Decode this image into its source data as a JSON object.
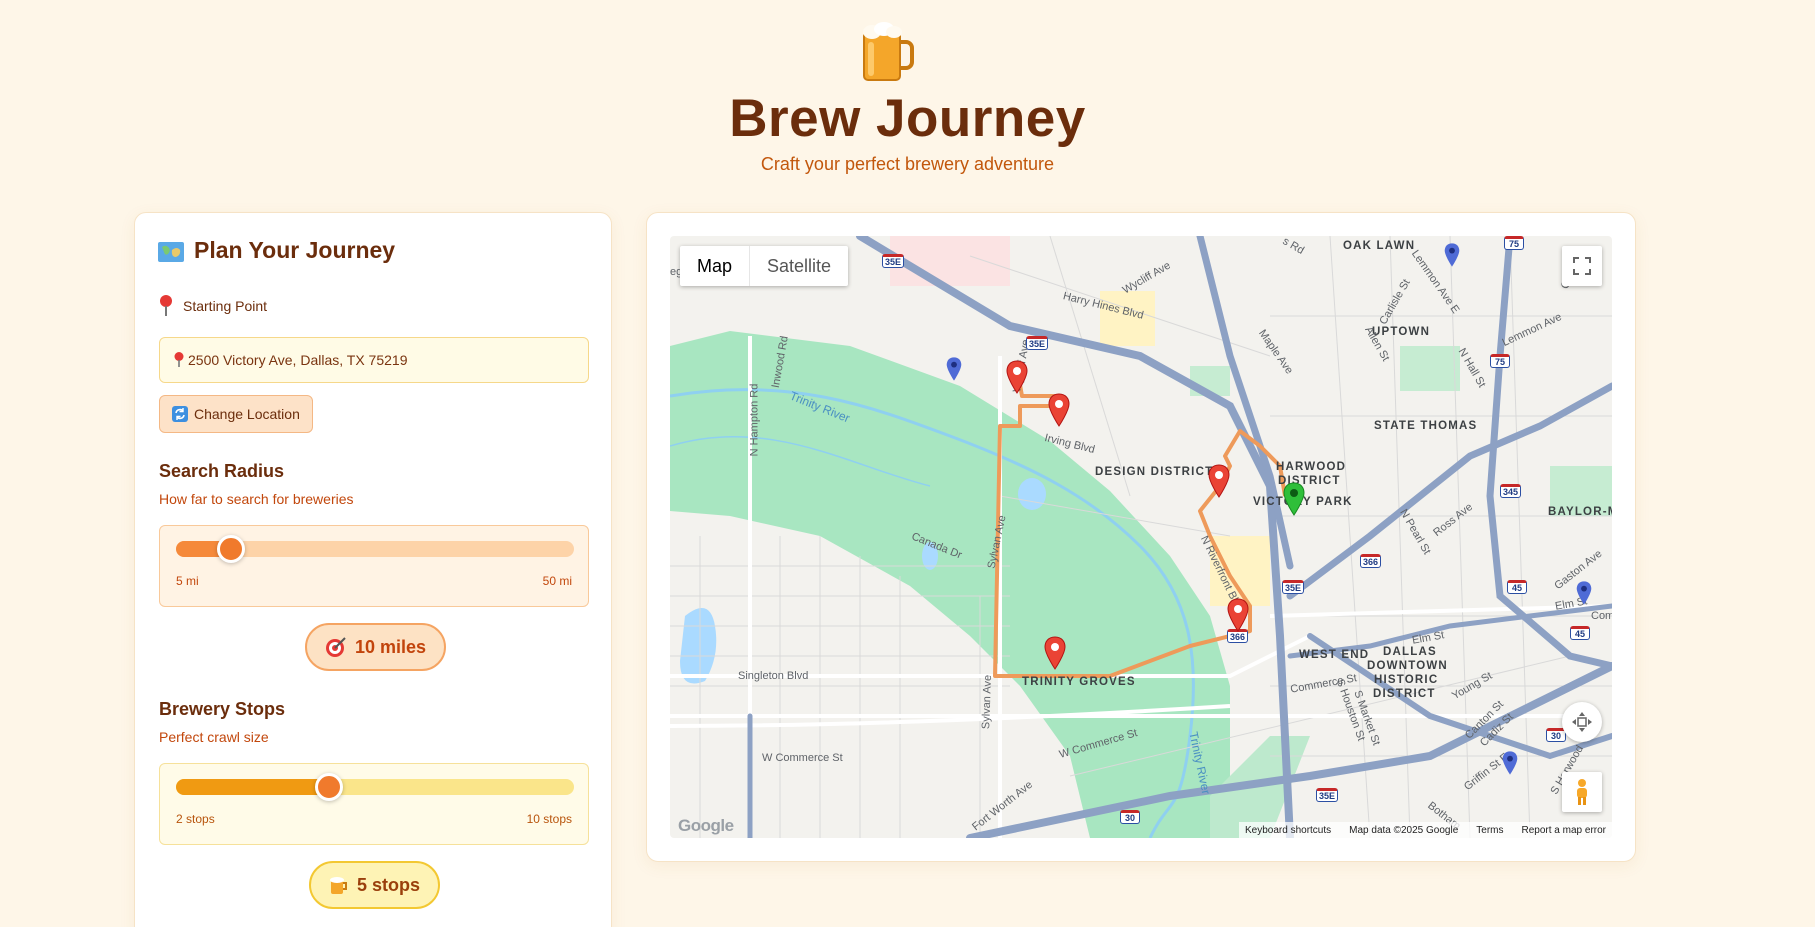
{
  "header": {
    "title": "Brew Journey",
    "tagline": "Craft your perfect brewery adventure"
  },
  "planner": {
    "title": "Plan Your Journey",
    "starting_point_label": "Starting Point",
    "address": "2500 Victory Ave, Dallas, TX 75219",
    "change_location_label": "Change Location",
    "radius": {
      "title": "Search Radius",
      "subtitle": "How far to search for breweries",
      "min_label": "5 mi",
      "max_label": "50 mi",
      "min": 5,
      "max": 50,
      "value": 10,
      "display": "10 miles"
    },
    "stops": {
      "title": "Brewery Stops",
      "subtitle": "Perfect crawl size",
      "min_label": "2 stops",
      "max_label": "10 stops",
      "min": 2,
      "max": 10,
      "value": 5,
      "display": "5 stops"
    }
  },
  "map": {
    "type_options": [
      "Map",
      "Satellite"
    ],
    "selected_type": "Map",
    "neighborhoods": {
      "oak_lawn": "OAK LAWN",
      "uptown": "UPTOWN",
      "state_thomas": "STATE THOMAS",
      "harwood": "HARWOOD",
      "district": "DISTRICT",
      "victory_park": "VICTORY PARK",
      "design_district": "DESIGN DISTRICT",
      "baylor": "BAYLOR-M",
      "west_end": "WEST END",
      "dallas": "DALLAS",
      "downtown": "DOWNTOWN",
      "historic": "HISTORIC",
      "district2": "DISTRICT",
      "trinity_groves": "TRINITY GROVES"
    },
    "streets": {
      "harry_hines": "Harry Hines Blvd",
      "wycliff": "Wycliff Ave",
      "wycliff2": "Wycliff Ave",
      "maple": "Maple Ave",
      "lemmon_e": "Lemmon Ave E",
      "lemmon": "Lemmon Ave",
      "carlisle": "Carlisle St",
      "allen": "Allen St",
      "n_hall": "N Hall St",
      "irving": "Irving Blvd",
      "n_hampton": "N Hampton Rd",
      "inwood": "Inwood Rd",
      "canada": "Canada Dr",
      "sylvan": "Sylvan Ave",
      "sylvan2": "Sylvan Ave",
      "riverfront": "N Riverfront Blvd",
      "n_pearl": "N Pearl St",
      "ross": "Ross Ave",
      "gaston": "Gaston Ave",
      "elm": "Elm St",
      "elm2": "Elm St",
      "commerce": "Commerce St",
      "s_houston": "S Houston St",
      "s_market": "S Market St",
      "young": "Young St",
      "canton": "Canton St",
      "cadiz": "Cadiz St",
      "singleton": "Singleton Blvd",
      "w_commerce": "W Commerce St",
      "w_commerce2": "W Commerce St",
      "fort_worth": "Fort Worth Ave",
      "griffin": "Griffin St E",
      "harwood": "S Harwood",
      "botham": "Botham",
      "trinity_river": "Trinity River",
      "trinity_river2": "Trinity River",
      "cl": "Co",
      "comm_r": "Comr",
      "ol_rd": "s Rd",
      "eg": "eg"
    },
    "highways": {
      "h35e_a": "35E",
      "h35e_b": "35E",
      "h35e_c": "35E",
      "h35e_d": "35E",
      "h75a": "75",
      "h75b": "75",
      "h345": "345",
      "h45a": "45",
      "h45b": "45",
      "h366a": "366",
      "h366b": "366",
      "h30a": "30",
      "h30b": "30"
    },
    "attribution": [
      "Keyboard shortcuts",
      "Map data ©2025 Google",
      "Terms",
      "Report a map error"
    ],
    "logo_text": "Google",
    "colors": {
      "route": "#ee9a5a",
      "park": "#a8e6c1",
      "water": "#aadaff",
      "highway": "#8da1c4",
      "brewery_pin": "#ea4335",
      "start_pin": "#2fbf3a",
      "poi_pin": "#4f6bd6"
    }
  },
  "colors": {
    "page_bg": "#fef6e8",
    "title": "#6b2d0c",
    "accent_orange": "#f07a2c",
    "accent_yellow": "#f09a12"
  }
}
